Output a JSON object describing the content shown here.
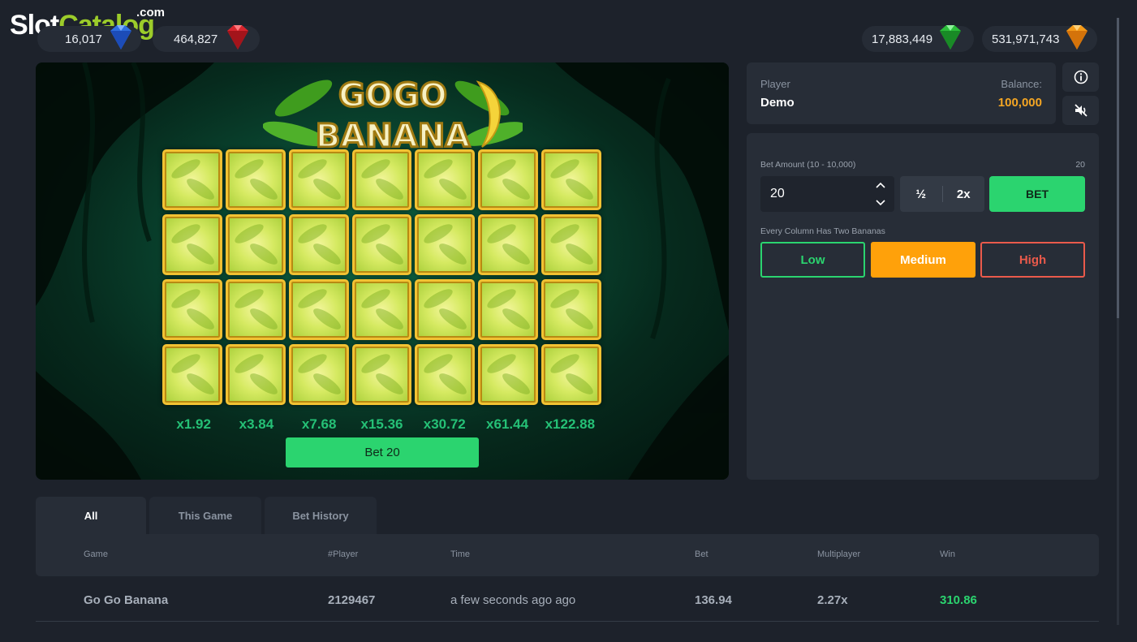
{
  "branding": {
    "slot": "Slot",
    "catalog": "Catalog",
    "com": ".com"
  },
  "jackpots": [
    {
      "value": "16,017",
      "gem": "blue-gem",
      "color": "#2f6fe0"
    },
    {
      "value": "464,827",
      "gem": "red-gem",
      "color": "#d8262e"
    },
    {
      "value": "17,883,449",
      "gem": "green-gem",
      "color": "#2bbd3a"
    },
    {
      "value": "531,971,743",
      "gem": "orange-gem",
      "color": "#f59a18"
    }
  ],
  "game": {
    "title_line1": "GOGO",
    "title_line2": "BANANA",
    "rows": 4,
    "columns": 7,
    "multipliers": [
      "x1.92",
      "x3.84",
      "x7.68",
      "x15.36",
      "x30.72",
      "x61.44",
      "x122.88"
    ],
    "bet_button": "Bet 20"
  },
  "player": {
    "label": "Player",
    "name": "Demo",
    "balance_label": "Balance:",
    "balance": "100,000"
  },
  "controls": {
    "bet_amount_label": "Bet Amount (10 - 10,000)",
    "bet_amount_right": "20",
    "bet_value": "20",
    "half": "½",
    "double": "2x",
    "bet": "BET",
    "mode_label": "Every Column Has Two Bananas",
    "risk": {
      "low": "Low",
      "medium": "Medium",
      "high": "High"
    }
  },
  "history": {
    "tabs": [
      "All",
      "This Game",
      "Bet History"
    ],
    "columns": [
      "Game",
      "#Player",
      "Time",
      "Bet",
      "Multiplayer",
      "Win"
    ],
    "rows": [
      {
        "game": "Go Go Banana",
        "player": "2129467",
        "time": "a few seconds ago ago",
        "bet": "136.94",
        "multiplier": "2.27x",
        "win": "310.86"
      }
    ]
  },
  "colors": {
    "accent_green": "#2bd46f",
    "balance_orange": "#f5a623",
    "medium_orange": "#ffa10a",
    "high_red": "#ea5a4b"
  }
}
